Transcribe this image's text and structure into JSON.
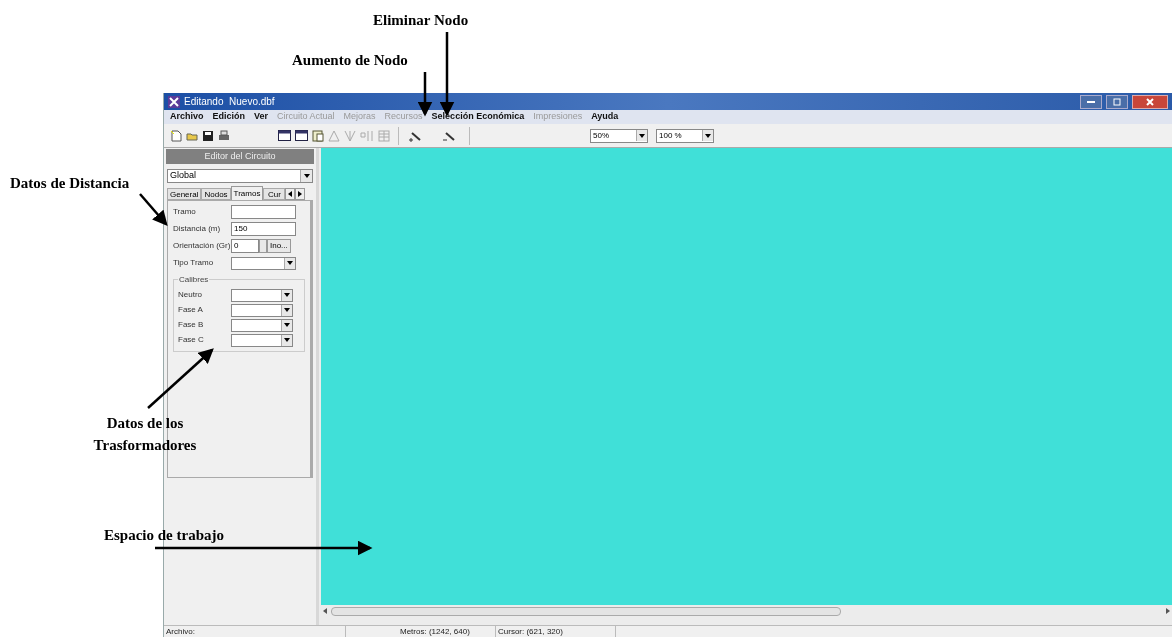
{
  "window": {
    "title": "Editando  Nuevo.dbf"
  },
  "menu": [
    {
      "label": "Archivo",
      "disabled": false
    },
    {
      "label": "Edición",
      "disabled": false
    },
    {
      "label": "Ver",
      "disabled": false
    },
    {
      "label": "Circuito Actual",
      "disabled": true
    },
    {
      "label": "Mejoras",
      "disabled": true
    },
    {
      "label": "Recursos",
      "disabled": true
    },
    {
      "label": "Selección Económica",
      "disabled": false
    },
    {
      "label": "Impresiones",
      "disabled": true
    },
    {
      "label": "Ayuda",
      "disabled": false
    }
  ],
  "zoom_combos": [
    "50%",
    "100 %"
  ],
  "editor": {
    "title": "Editor del Circuito",
    "scope": "Global",
    "tabs": [
      {
        "label": "General",
        "selected": false
      },
      {
        "label": "Nodos",
        "selected": false
      },
      {
        "label": "Tramos",
        "selected": true
      },
      {
        "label": "Cur",
        "selected": false
      }
    ],
    "fields": [
      {
        "label": "Tramo",
        "kind": "text"
      },
      {
        "label": "Distancia (m)",
        "kind": "text",
        "value": "150"
      },
      {
        "label": "Orientación (Gr)",
        "kind": "spin",
        "value": "0",
        "button": "Ino..."
      },
      {
        "label": "Tipo Tramo",
        "kind": "combo"
      }
    ],
    "group": {
      "title": "Calibres",
      "fields": [
        "Neutro",
        "Fase A",
        "Fase B",
        "Fase C"
      ]
    }
  },
  "status_bar": [
    "Archivo:",
    "Metros: (1242, 640)",
    "Cursor: (621, 320)"
  ],
  "annotations": [
    {
      "text": "Eliminar Nodo"
    },
    {
      "text": "Aumento de Nodo"
    },
    {
      "text": "Datos de Distancia"
    },
    {
      "text": "Datos de los Trasformadores"
    },
    {
      "text": "Espacio de trabajo"
    }
  ]
}
